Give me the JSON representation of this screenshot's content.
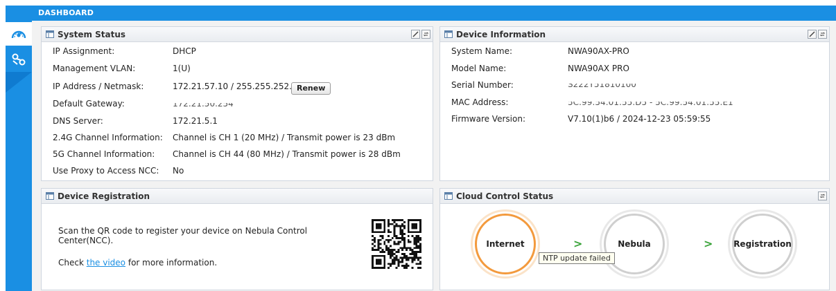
{
  "header": {
    "title": "DASHBOARD"
  },
  "sidebar": {
    "items": [
      {
        "icon": "dashboard-gauge-icon",
        "active": true
      },
      {
        "icon": "network-link-icon",
        "active": false
      }
    ]
  },
  "colors": {
    "accent": "#1a8fe3",
    "ring_internet": "#f39a3d",
    "ring_idle": "#cfcfcf",
    "arrow": "#3aa33a"
  },
  "system_status": {
    "title": "System Status",
    "rows": [
      {
        "label": "IP Assignment:",
        "value": "DHCP"
      },
      {
        "label": "Management VLAN:",
        "value": "1(U)"
      },
      {
        "label": "IP Address / Netmask:",
        "value": "172.21.57.10 / 255.255.252.0"
      },
      {
        "label": "Default Gateway:",
        "value": "172.21.50.254"
      },
      {
        "label": "DNS Server:",
        "value": "172.21.5.1"
      },
      {
        "label": "2.4G Channel Information:",
        "value": "Channel is CH 1 (20 MHz) / Transmit power is 23 dBm"
      },
      {
        "label": "5G Channel Information:",
        "value": "Channel is CH 44 (80 MHz) / Transmit power is 28 dBm"
      },
      {
        "label": "Use Proxy to Access NCC:",
        "value": "No"
      }
    ],
    "renew_label": "Renew"
  },
  "device_information": {
    "title": "Device Information",
    "rows": [
      {
        "label": "System Name:",
        "value": "NWA90AX-PRO"
      },
      {
        "label": "Model Name:",
        "value": "NWA90AX PRO"
      },
      {
        "label": "Serial Number:",
        "value": "S222Y51810100"
      },
      {
        "label": "MAC Address:",
        "value": "5C:99:54:01:55:D5 - 5C:99:54:01:55:E1"
      },
      {
        "label": "Firmware Version:",
        "value": "V7.10(1)b6 / 2024-12-23 05:59:55"
      }
    ]
  },
  "device_registration": {
    "title": "Device Registration",
    "message": "Scan the QR code to register your device on Nebula Control Center(NCC).",
    "check_prefix": "Check ",
    "check_link": "the video",
    "check_suffix": " for more information."
  },
  "cloud_control": {
    "title": "Cloud Control Status",
    "nodes": [
      "Internet",
      "Nebula",
      "Registration"
    ],
    "arrow": ">",
    "tooltip": "NTP update failed"
  }
}
